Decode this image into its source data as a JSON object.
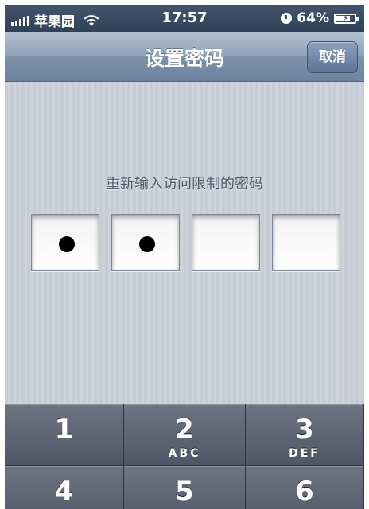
{
  "status_bar": {
    "carrier": "苹果园",
    "time": "17:57",
    "battery_percent": "64%",
    "icons": [
      "signal-icon",
      "wifi-icon",
      "clock-icon",
      "battery-charging-icon"
    ]
  },
  "nav": {
    "title": "设置密码",
    "cancel_label": "取消"
  },
  "prompt": "重新输入访问限制的密码",
  "passcode": {
    "length": 4,
    "filled": 2
  },
  "keypad": [
    {
      "digit": "1",
      "letters": ""
    },
    {
      "digit": "2",
      "letters": "ABC"
    },
    {
      "digit": "3",
      "letters": "DEF"
    },
    {
      "digit": "4",
      "letters": ""
    },
    {
      "digit": "5",
      "letters": ""
    },
    {
      "digit": "6",
      "letters": ""
    }
  ],
  "colors": {
    "navbar": "#8ea0b8",
    "background": "#c9cfd8",
    "keypad": "#5a6272"
  }
}
